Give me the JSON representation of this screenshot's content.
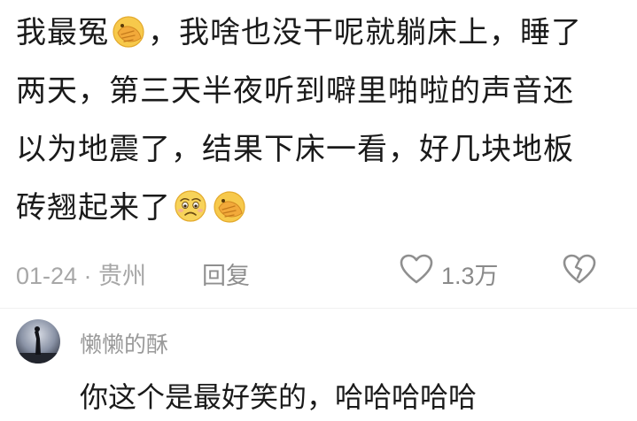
{
  "comment": {
    "lines": [
      [
        "我最冤",
        "，我啥也没干呢就躺床上，睡了"
      ],
      [
        "两天，第三天半夜听到噼里啪啦的声音还"
      ],
      [
        "以为地震了，结果下床一看，好几块地板"
      ],
      [
        "砖翘起来了"
      ]
    ],
    "emojis": [
      "facepalm-emoji",
      "facepalm-emoji",
      "crying-sad-emoji",
      "facepalm-emoji"
    ]
  },
  "meta": {
    "date_location": "01-24 · 贵州",
    "reply_label": "回复",
    "like_count": "1.3万"
  },
  "reply": {
    "username": "懒懒的酥",
    "text": "你这个是最好笑的，哈哈哈哈哈"
  },
  "colors": {
    "text": "#1a1a1a",
    "meta": "#a0a0a0",
    "emoji_fill": "#f7c94b",
    "emoji_hand": "#f0a93c"
  }
}
